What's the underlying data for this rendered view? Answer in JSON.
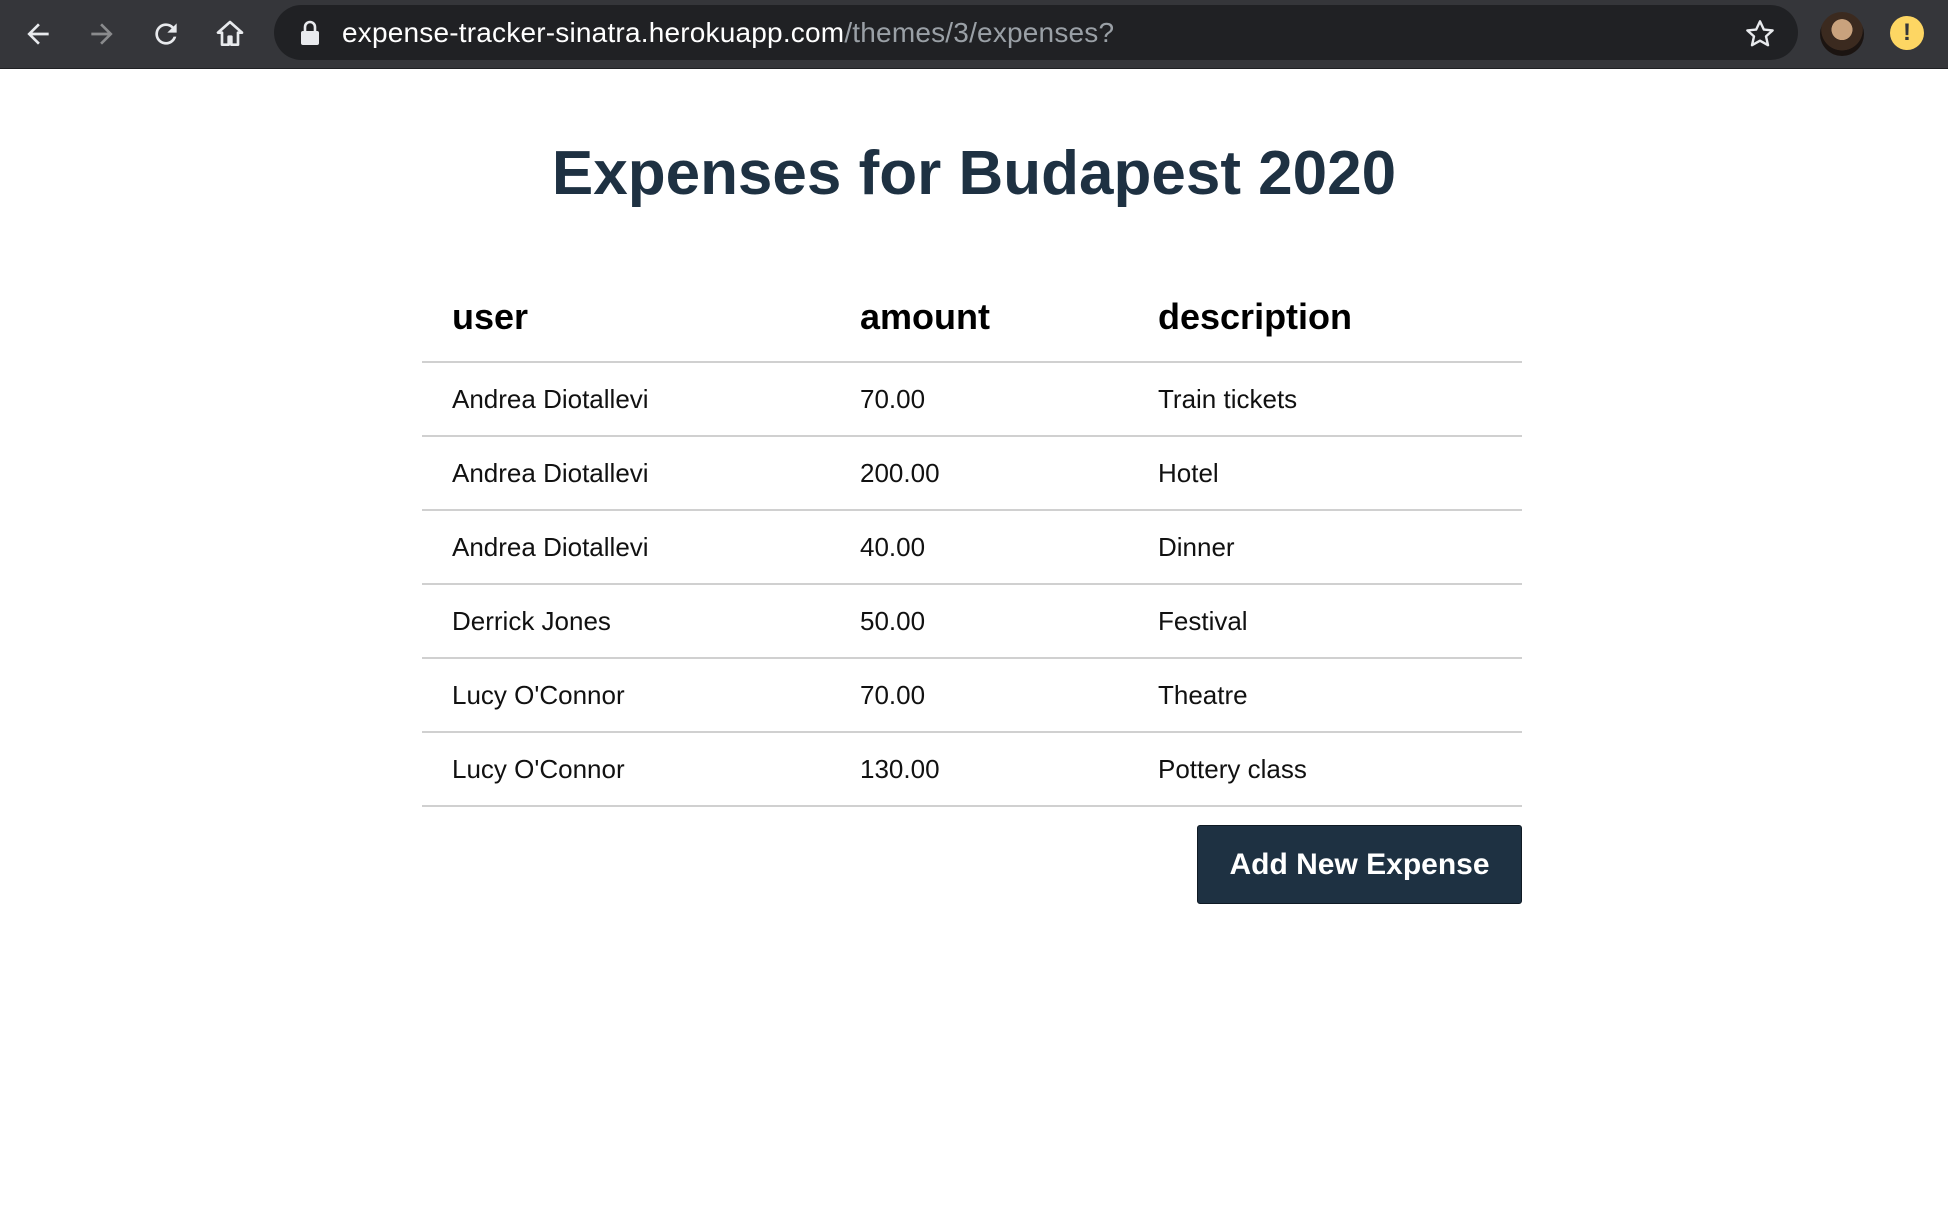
{
  "browser": {
    "url_host": "expense-tracker-sinatra.herokuapp.com",
    "url_path": "/themes/3/expenses?",
    "icons": [
      "back-arrow-icon",
      "forward-arrow-icon",
      "reload-icon",
      "home-icon",
      "lock-icon",
      "bookmark-star-icon",
      "profile-avatar",
      "alert-icon"
    ],
    "alert_glyph": "!"
  },
  "page": {
    "title": "Expenses for Budapest 2020"
  },
  "table": {
    "headers": [
      "user",
      "amount",
      "description"
    ],
    "rows": [
      {
        "user": "Andrea Diotallevi",
        "amount": "70.00",
        "description": "Train tickets"
      },
      {
        "user": "Andrea Diotallevi",
        "amount": "200.00",
        "description": "Hotel"
      },
      {
        "user": "Andrea Diotallevi",
        "amount": "40.00",
        "description": "Dinner"
      },
      {
        "user": "Derrick Jones",
        "amount": "50.00",
        "description": "Festival"
      },
      {
        "user": "Lucy O'Connor",
        "amount": "70.00",
        "description": "Theatre"
      },
      {
        "user": "Lucy O'Connor",
        "amount": "130.00",
        "description": "Pottery class"
      }
    ]
  },
  "actions": {
    "add_label": "Add New Expense"
  },
  "colors": {
    "primary": "#1e3142",
    "browser_bar": "#35363a",
    "omnibox": "#202124",
    "alert": "#fdd663"
  }
}
